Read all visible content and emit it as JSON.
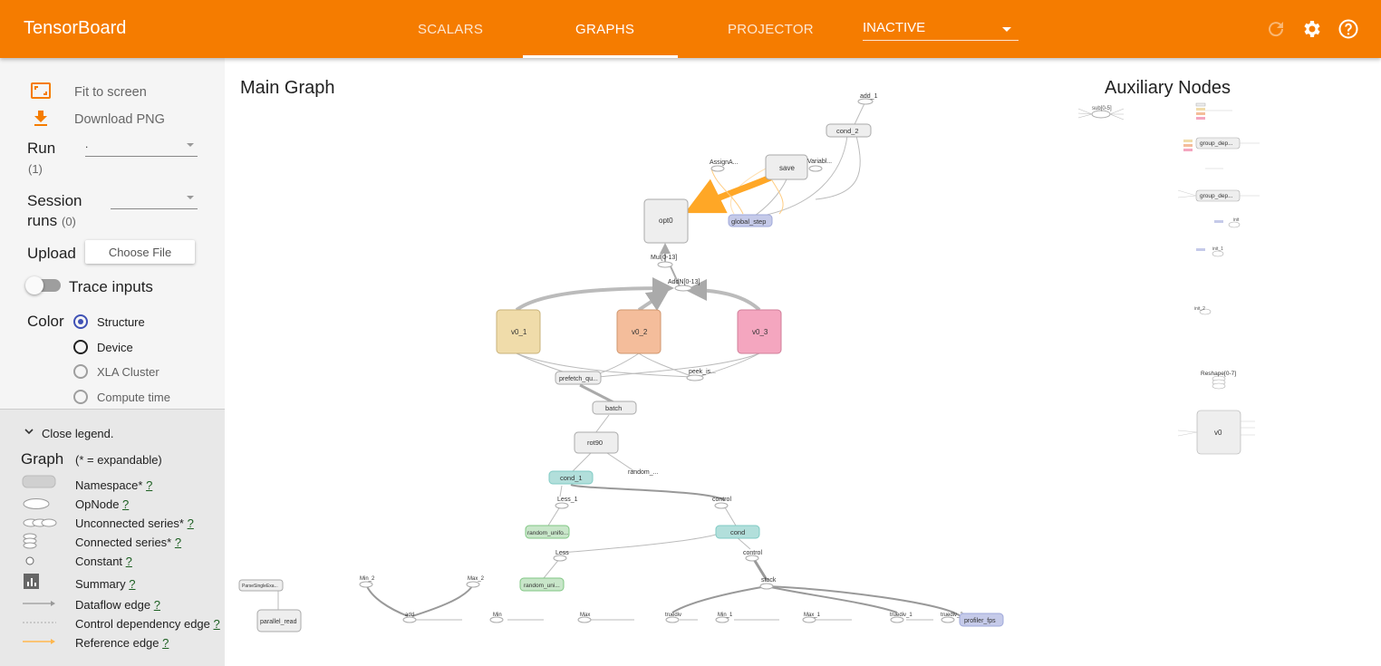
{
  "header": {
    "brand": "TensorBoard",
    "tabs": [
      {
        "label": "SCALARS"
      },
      {
        "label": "GRAPHS",
        "active": true
      },
      {
        "label": "PROJECTOR"
      }
    ],
    "inactive_label": "INACTIVE",
    "colors": {
      "header_bg": "#f57c00",
      "text": "#ffffff"
    }
  },
  "sidebar": {
    "fit_to_screen": "Fit to screen",
    "download_png": "Download PNG",
    "run_label": "Run",
    "run_count": "(1)",
    "run_value": ".",
    "session_label_1": "Session",
    "session_label_2": "runs",
    "session_count": "(0)",
    "upload_label": "Upload",
    "choose_file": "Choose File",
    "trace_inputs": "Trace inputs",
    "color_label": "Color",
    "color_options": [
      {
        "label": "Structure",
        "selected": true
      },
      {
        "label": "Device"
      },
      {
        "label": "XLA Cluster"
      },
      {
        "label": "Compute time"
      }
    ]
  },
  "legend": {
    "close": "Close legend.",
    "graph": "Graph",
    "expandable": "(* = expandable)",
    "help_mark": "?",
    "items": [
      {
        "label": "Namespace*",
        "icon": "namespace-icon"
      },
      {
        "label": "OpNode",
        "icon": "opnode-icon"
      },
      {
        "label": "Unconnected series*",
        "icon": "unconnected-series-icon"
      },
      {
        "label": "Connected series*",
        "icon": "connected-series-icon"
      },
      {
        "label": "Constant",
        "icon": "constant-icon"
      },
      {
        "label": "Summary",
        "icon": "summary-icon"
      },
      {
        "label": "Dataflow edge",
        "icon": "dataflow-edge-icon"
      },
      {
        "label": "Control dependency edge",
        "icon": "control-edge-icon"
      },
      {
        "label": "Reference edge",
        "icon": "reference-edge-icon"
      }
    ]
  },
  "graph": {
    "main_title": "Main Graph",
    "aux_title": "Auxiliary Nodes",
    "nodes": {
      "add1": "add_1",
      "cond2": "cond_2",
      "assign": "AssignA...",
      "save": "save",
      "variable": "Variabl...",
      "opt0": "opt0",
      "global_step": "global_step",
      "mul": "Mul[0-13]",
      "addn": "AddN[0-13]",
      "v0_1": "v0_1",
      "v0_2": "v0_2",
      "v0_3": "v0_3",
      "prefetch": "prefetch_qu...",
      "peek": "peek_is...",
      "batch": "batch",
      "rot90": "rot90",
      "cond1": "cond_1",
      "random": "random_...",
      "less1": "Less_1",
      "control": "control",
      "random_unifo": "random_unifo...",
      "cond": "cond",
      "less": "Less",
      "control2": "control",
      "random_uni": "random_uni...",
      "stack": "stack",
      "parse": "ParseSingleExa...",
      "parallel_read": "parallel_read",
      "min2": "Min_2",
      "max2": "Max_2",
      "add": "add",
      "min": "Min",
      "max": "Max",
      "truediv": "truediv",
      "min1": "Min_1",
      "max1": "Max_1",
      "truediv1": "truediv_1",
      "truediv2": "truediv_2",
      "profiler": "profiler_fps"
    },
    "aux": {
      "sub": "sub[0-5]",
      "group_dep1": "group_dep...",
      "group_dep2": "group_dep...",
      "reshape": "Reshape[0-7]",
      "v0": "v0",
      "init": "init",
      "init1": "init_1",
      "init2": "init_2"
    }
  }
}
